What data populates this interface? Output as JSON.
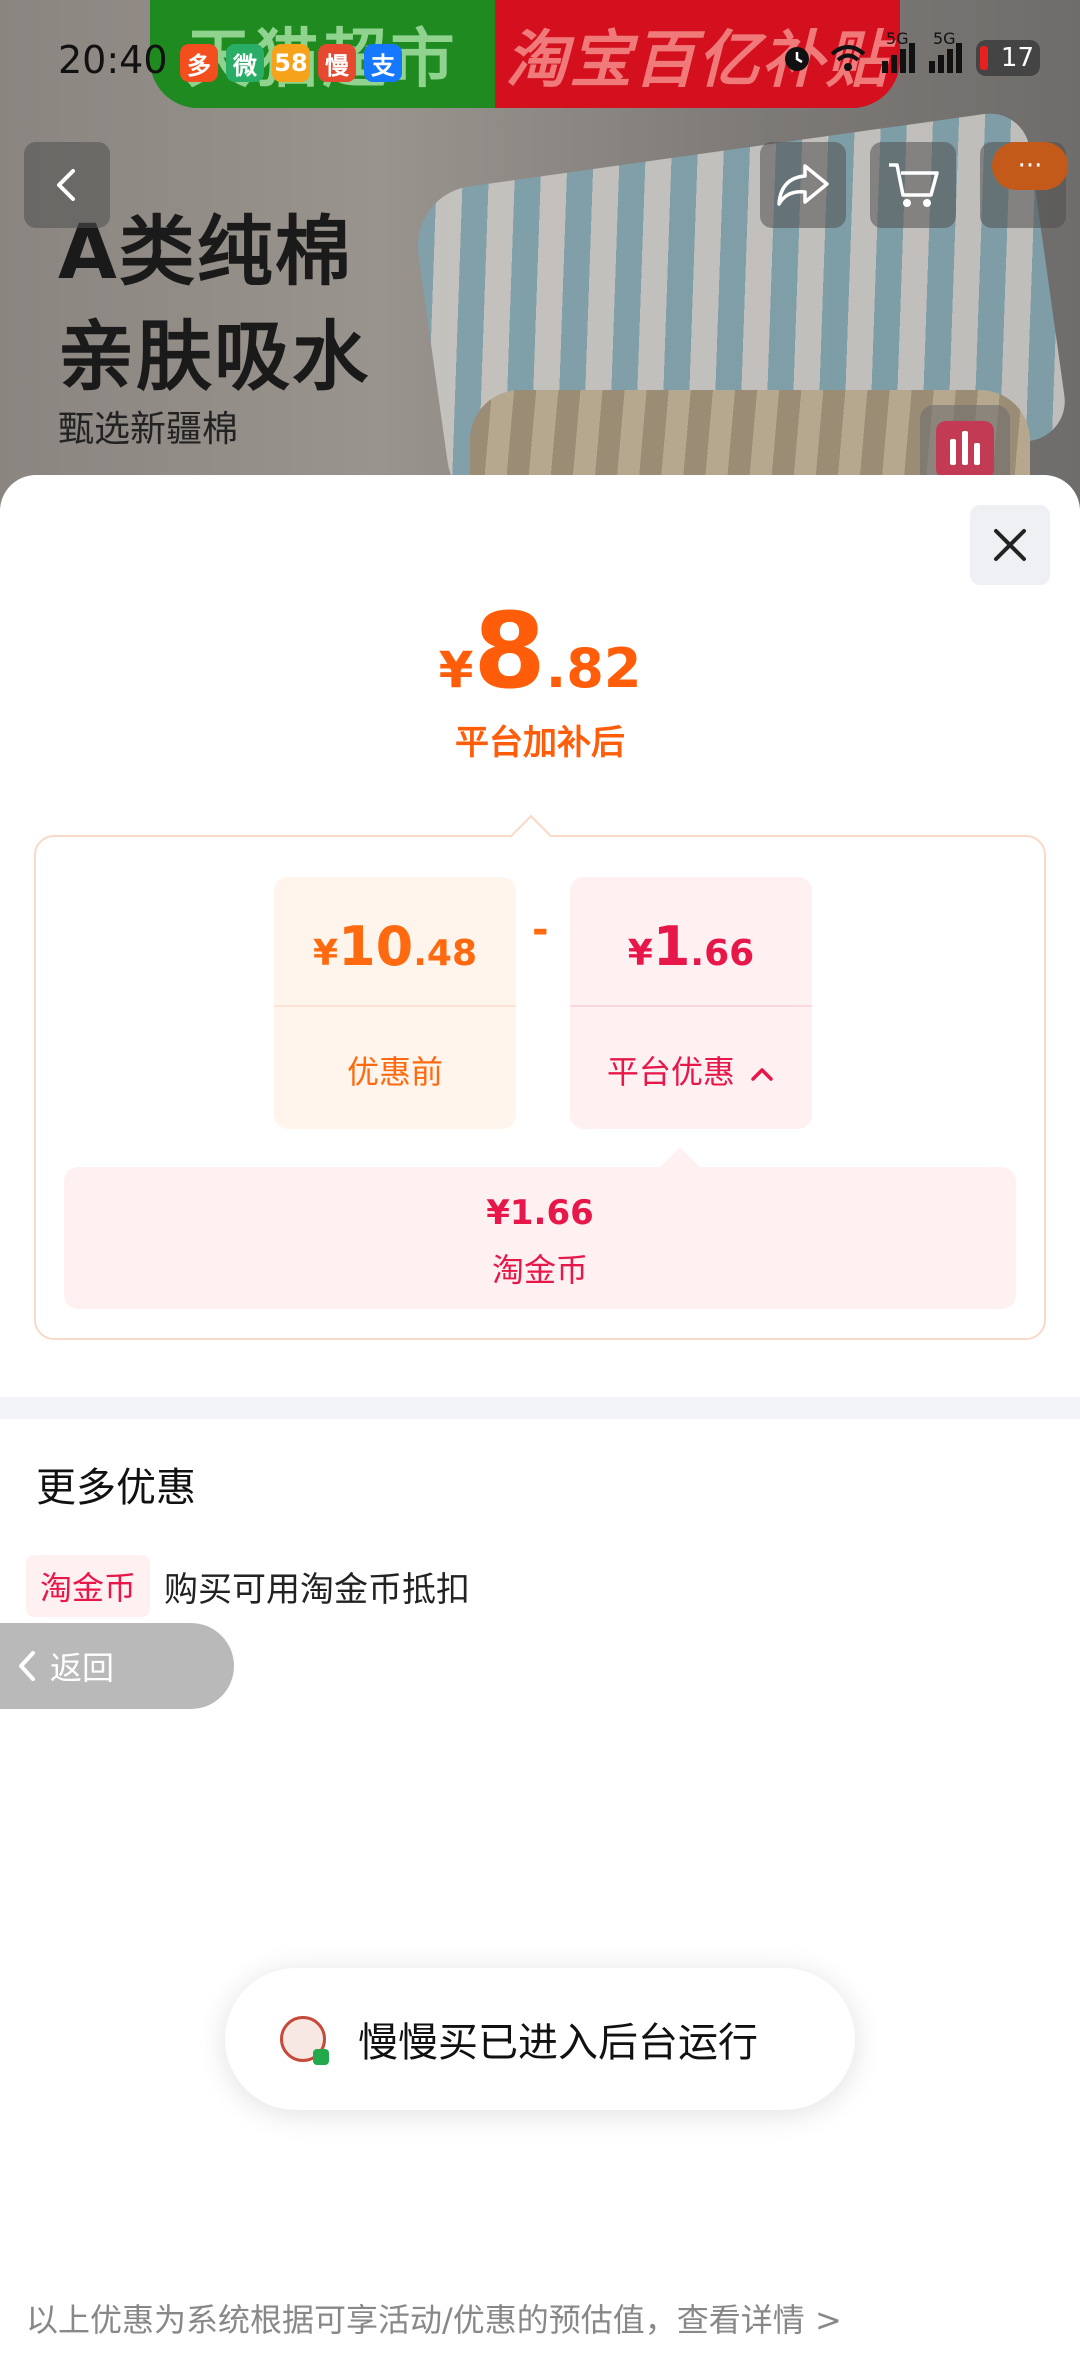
{
  "status_bar": {
    "time": "20:40",
    "battery": "17",
    "network_1": "5G",
    "network_2": "5G",
    "app_icons": [
      {
        "name": "pinduoduo-icon",
        "glyph": "多",
        "color": "#f24e1e"
      },
      {
        "name": "wechat-icon",
        "glyph": "微",
        "color": "#2aae67"
      },
      {
        "name": "58-icon",
        "glyph": "58",
        "color": "#f7a21b"
      },
      {
        "name": "manman-icon",
        "glyph": "慢",
        "color": "#e5492f"
      },
      {
        "name": "alipay-icon",
        "glyph": "支",
        "color": "#1677ff"
      }
    ]
  },
  "banner": {
    "left_text": "天猫超市",
    "right_text": "淘宝百亿补贴"
  },
  "hero": {
    "line1": "A类纯棉",
    "line2": "亲肤吸水",
    "subtitle": "甄选新疆棉"
  },
  "price": {
    "currency": "¥",
    "integer": "8",
    "decimal": ".82",
    "caption": "平台加补后"
  },
  "breakdown": {
    "before": {
      "currency": "¥",
      "integer": "10",
      "decimal": ".48",
      "label": "优惠前"
    },
    "operator": "-",
    "discount": {
      "currency": "¥",
      "integer": "1",
      "decimal": ".66",
      "label": "平台优惠"
    },
    "coin": {
      "amount": "¥1.66",
      "label": "淘金币"
    }
  },
  "more_offers": {
    "title": "更多优惠",
    "tag": "淘金币",
    "text": "购买可用淘金币抵扣"
  },
  "return_pill": {
    "label": "返回"
  },
  "toast": {
    "text": "慢慢买已进入后台运行"
  },
  "footer": {
    "note": "以上优惠为系统根据可享活动/优惠的预估值，查看详情 >"
  },
  "colors": {
    "accent_orange": "#ff5d0a",
    "accent_red": "#e8174a"
  }
}
